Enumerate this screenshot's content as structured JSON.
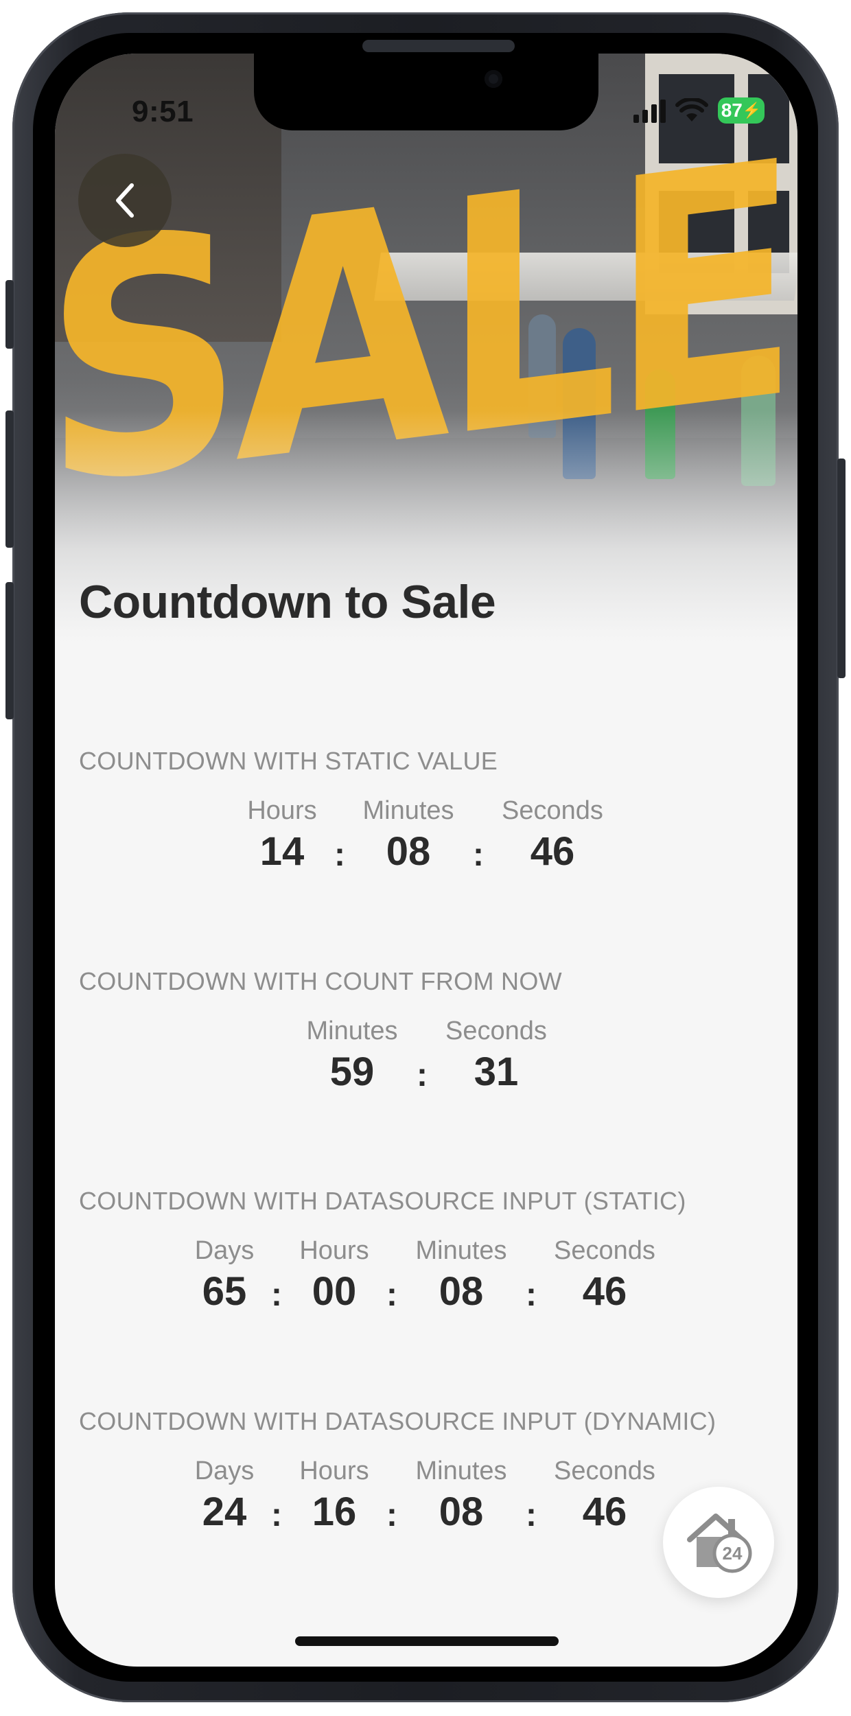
{
  "status_bar": {
    "time": "9:51",
    "battery": "87"
  },
  "header": {
    "title": "Countdown to Sale",
    "hero_text": "SALE"
  },
  "sections": [
    {
      "label": "COUNTDOWN WITH STATIC VALUE",
      "units": [
        {
          "label": "Hours",
          "value": "14"
        },
        {
          "label": "Minutes",
          "value": "08"
        },
        {
          "label": "Seconds",
          "value": "46"
        }
      ]
    },
    {
      "label": "COUNTDOWN WITH COUNT FROM NOW",
      "units": [
        {
          "label": "Minutes",
          "value": "59"
        },
        {
          "label": "Seconds",
          "value": "31"
        }
      ]
    },
    {
      "label": "COUNTDOWN WITH DATASOURCE INPUT (STATIC)",
      "units": [
        {
          "label": "Days",
          "value": "65"
        },
        {
          "label": "Hours",
          "value": "00"
        },
        {
          "label": "Minutes",
          "value": "08"
        },
        {
          "label": "Seconds",
          "value": "46"
        }
      ]
    },
    {
      "label": "COUNTDOWN WITH DATASOURCE INPUT (DYNAMIC)",
      "units": [
        {
          "label": "Days",
          "value": "24"
        },
        {
          "label": "Hours",
          "value": "16"
        },
        {
          "label": "Minutes",
          "value": "08"
        },
        {
          "label": "Seconds",
          "value": "46"
        }
      ]
    }
  ],
  "separator": ":",
  "fab": {
    "badge": "24",
    "icon": "home-icon"
  },
  "colors": {
    "accent_battery": "#34c759",
    "sale_yellow": "#f5b52a",
    "text_dark": "#2b2b2b",
    "text_muted": "#8d8d8d"
  }
}
